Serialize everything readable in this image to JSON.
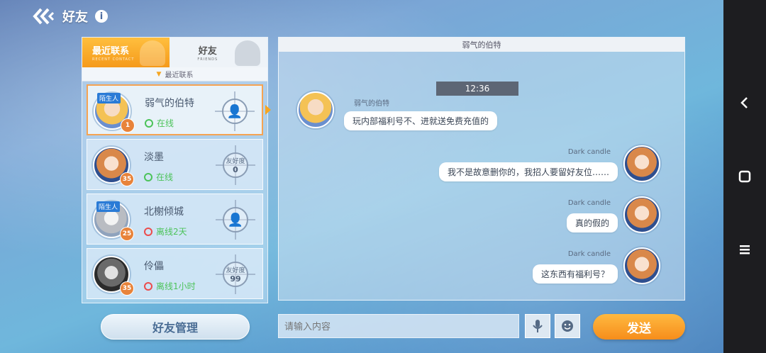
{
  "header": {
    "title": "好友",
    "info_icon": "i"
  },
  "tabs": [
    {
      "label": "最近联系",
      "sub": "RECENT CONTACT"
    },
    {
      "label": "好友",
      "sub": "FRIENDS"
    }
  ],
  "section_label": "最近联系",
  "contacts": [
    {
      "name": "弱气的伯特",
      "status": "在线",
      "stranger": "陌生人",
      "level": "1",
      "avatar": "blond"
    },
    {
      "name": "淡墨",
      "status": "在线",
      "level": "35",
      "favor_label": "友好度",
      "favor_value": "0",
      "avatar": "orange"
    },
    {
      "name": "北榭倾城",
      "status": "离线2天",
      "stranger": "陌生人",
      "level": "25",
      "avatar": "grey"
    },
    {
      "name": "伶儡",
      "status": "离线1小时",
      "level": "35",
      "favor_label": "友好度",
      "favor_value": "99",
      "avatar": "dark"
    }
  ],
  "manage_button": "好友管理",
  "chat": {
    "title": "弱气的伯特",
    "timestamp": "12:36",
    "messages": [
      {
        "sender": "弱气的伯特",
        "text": "玩内部福利号不、进就送免费充值的",
        "side": "left"
      },
      {
        "sender": "Dark candle",
        "text": "我不是故意删你的，我招人要留好友位……",
        "side": "right"
      },
      {
        "sender": "Dark candle",
        "text": "真的假的",
        "side": "right"
      },
      {
        "sender": "Dark candle",
        "text": "这东西有福利号？",
        "side": "right"
      }
    ]
  },
  "input": {
    "placeholder": "请输入内容"
  },
  "send_button": "发送",
  "colors": {
    "accent": "#f5a623",
    "online": "#4cc35a",
    "offline": "#ec4c4c",
    "stranger": "#2a7bd6"
  }
}
